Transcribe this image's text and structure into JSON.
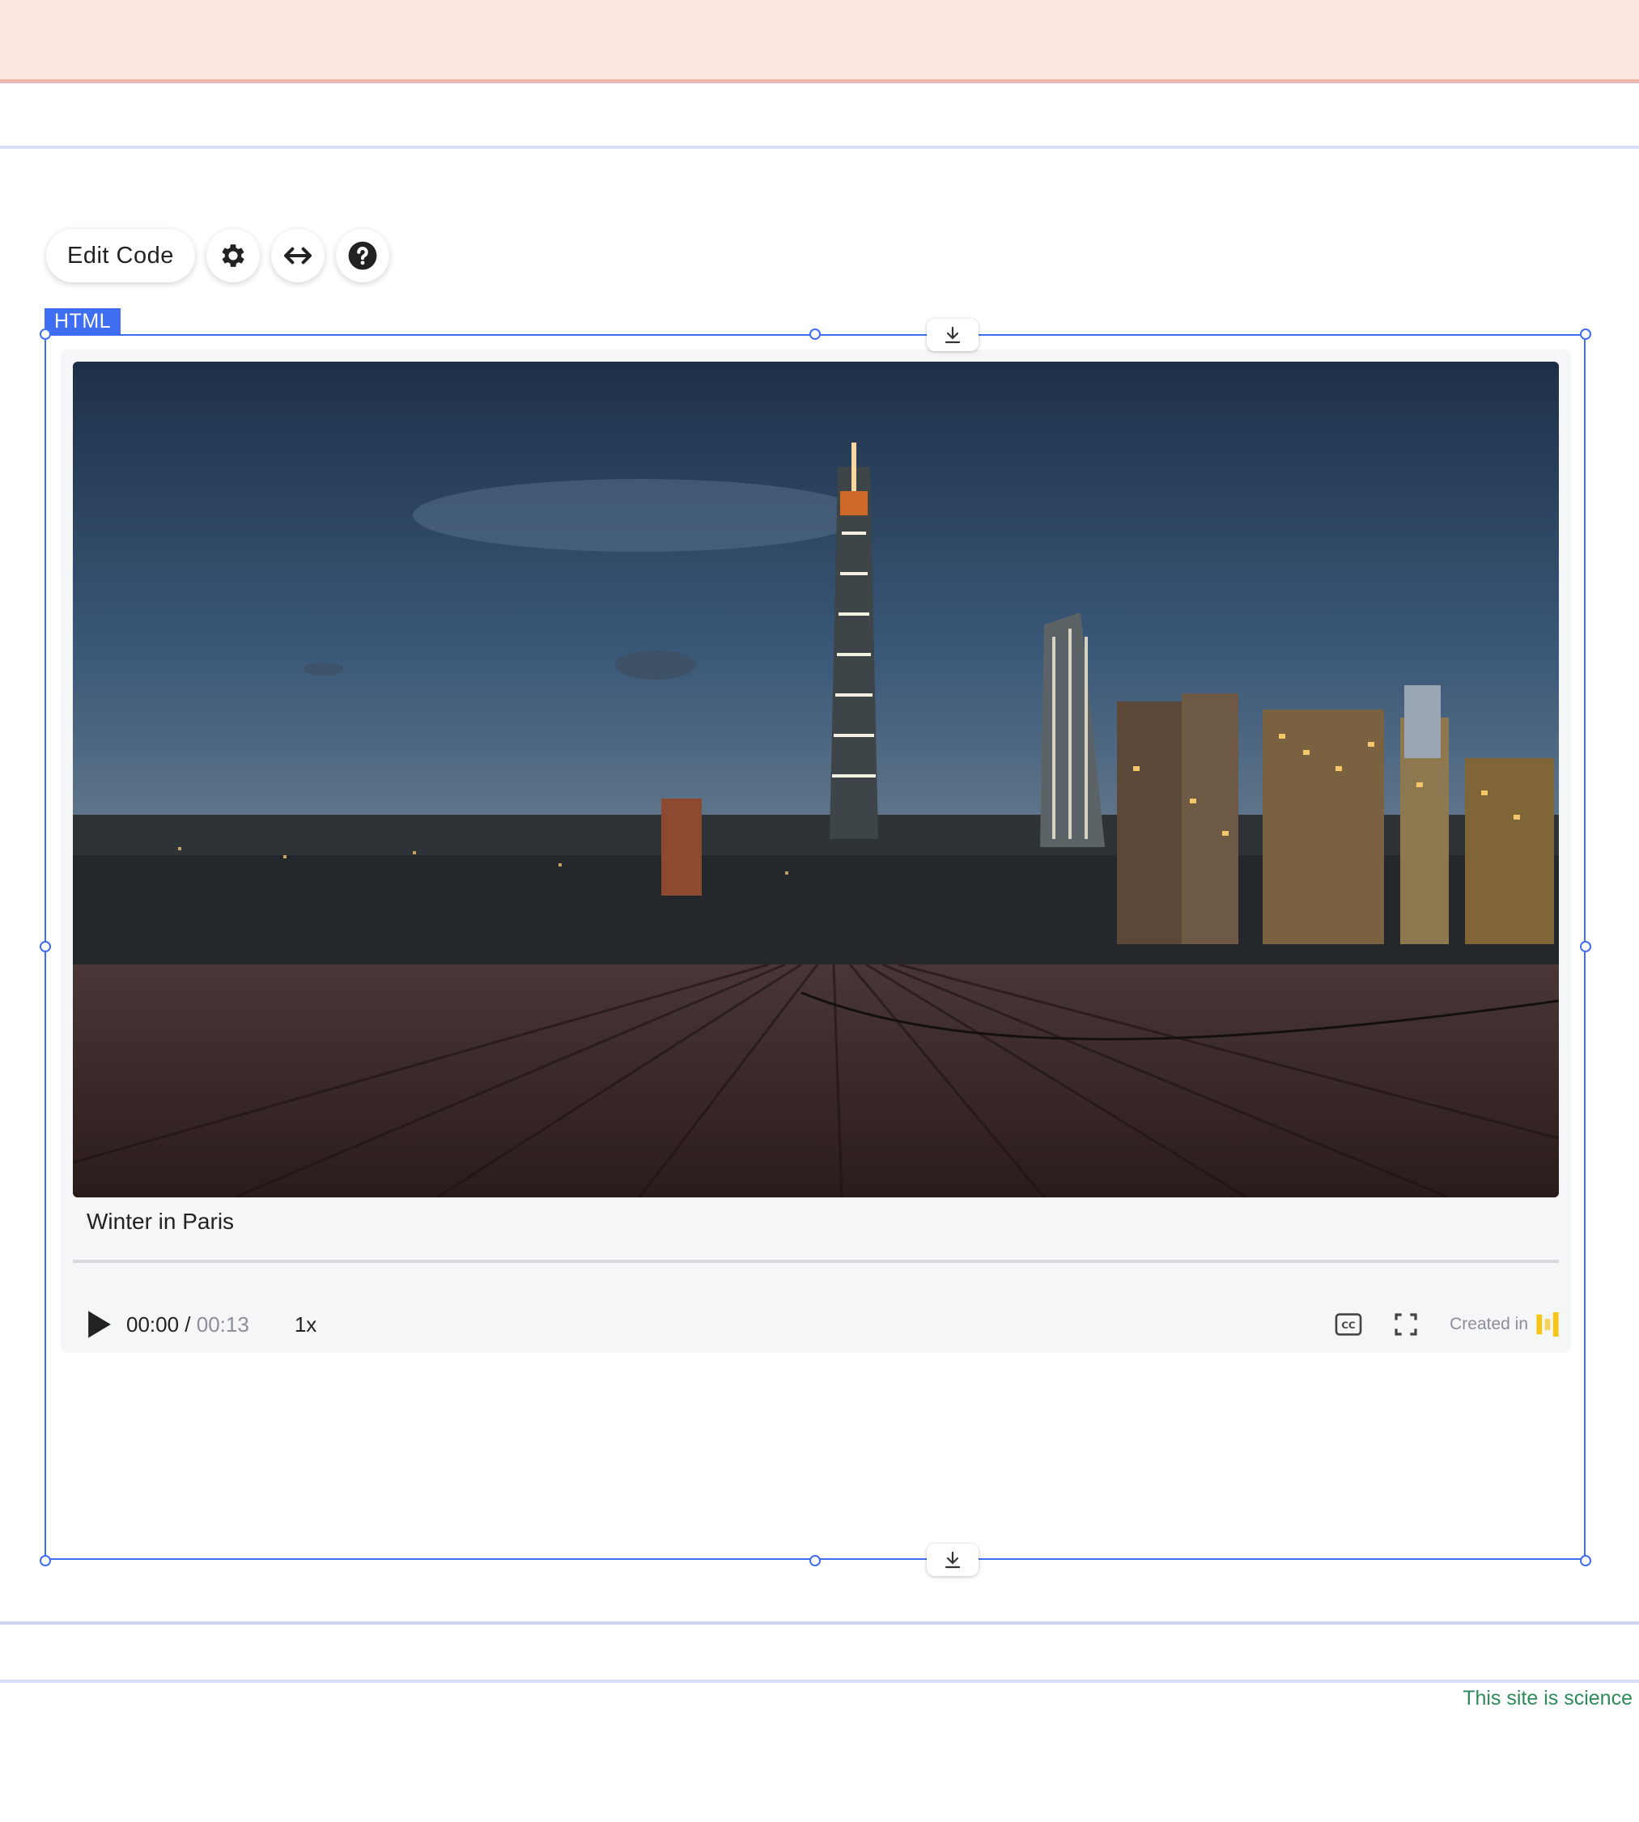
{
  "toolbar": {
    "edit_code_label": "Edit Code",
    "settings_icon": "gear-icon",
    "stretch_icon": "horizontal-arrows-icon",
    "help_icon": "question-circle-icon"
  },
  "element_tag": "HTML",
  "video": {
    "title": "Winter in Paris",
    "current_time": "00:00",
    "separator": " / ",
    "total_time": "00:13",
    "speed": "1x",
    "progress": 0,
    "created_in_label": "Created in"
  },
  "footer": {
    "text": "This site is science"
  },
  "colors": {
    "selection": "#3f6ef3",
    "topbar": "#fde8e1",
    "brand_logo": "#f5c518",
    "footer_text": "#2f8a5a"
  }
}
